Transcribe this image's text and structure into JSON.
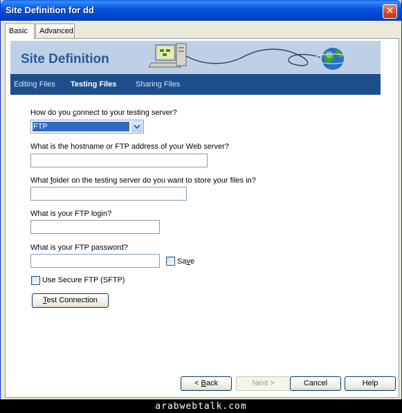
{
  "window": {
    "title": "Site Definition for dd",
    "close_glyph": "✕"
  },
  "tabs": [
    {
      "label": "Basic",
      "active": true
    },
    {
      "label": "Advanced",
      "active": false
    }
  ],
  "banner": {
    "title": "Site Definition"
  },
  "subnav": [
    {
      "label": "Editing Files",
      "active": false
    },
    {
      "label": "Testing Files",
      "active": true
    },
    {
      "label": "Sharing Files",
      "active": false
    }
  ],
  "form": {
    "connect_q_pre": "How do you ",
    "connect_q_ul": "c",
    "connect_q_post": "onnect to your testing server?",
    "connect_value": "FTP",
    "hostname_q": "What is the hostname or FTP address of your Web server?",
    "hostname_value": "",
    "folder_q_pre": "What ",
    "folder_q_ul": "f",
    "folder_q_post": "older on the testing server do you want to store your files in?",
    "folder_value": "",
    "login_q": "What is your FTP login?",
    "login_value": "",
    "password_q": "What is your FTP password?",
    "password_value": "",
    "save_pre": "Sa",
    "save_ul": "v",
    "save_post": "e",
    "save_checked": false,
    "sftp_label": "Use Secure FTP (SFTP)",
    "sftp_checked": false,
    "test_ul": "T",
    "test_post": "est Connection"
  },
  "buttons": {
    "back_pre": "< ",
    "back_ul": "B",
    "back_post": "ack",
    "next_label": "Next >",
    "cancel_label": "Cancel",
    "help_label": "Help"
  },
  "footer": {
    "watermark": "arabwebtalk.com"
  },
  "colors": {
    "titlebar": "#0a55e0",
    "banner": "#bed0e6",
    "subnav": "#1d4f8c",
    "selection": "#316ac5"
  }
}
